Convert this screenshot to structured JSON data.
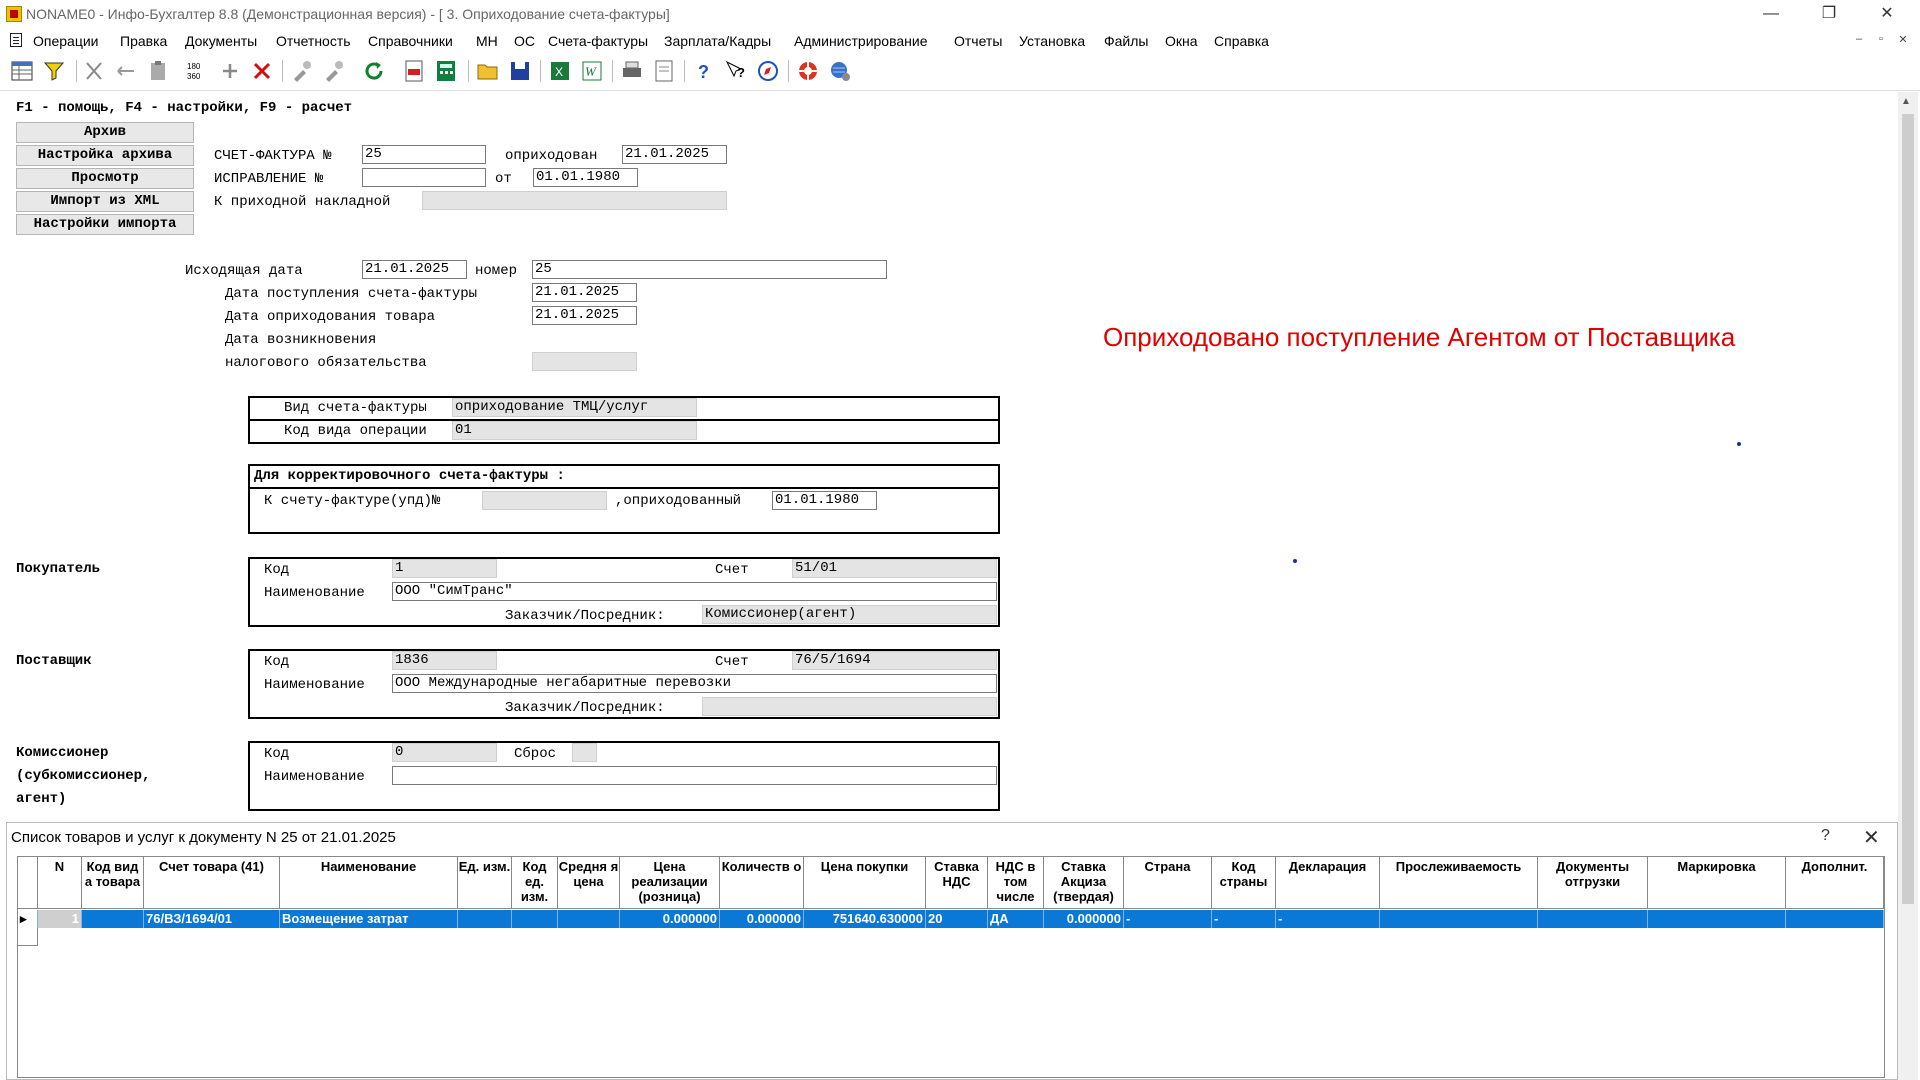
{
  "window": {
    "title": "NONAME0 - Инфо-Бухгалтер 8.8 (Демонстрационная версия) - [  3. Оприходование счета-фактуры]"
  },
  "menu": [
    "Операции",
    "Правка",
    "Документы",
    "Отчетность",
    "Справочники",
    "МН",
    "ОС",
    "Счета-фактуры",
    "Зарплата/Кадры",
    "Администрирование",
    "Отчеты",
    "Установка",
    "Файлы",
    "Окна",
    "Справка"
  ],
  "toolbar_icons": [
    "table-icon",
    "filter-icon",
    "cut-icon",
    "move-icon",
    "paste-icon",
    "number-icon",
    "add-icon",
    "delete-icon",
    "tool-icon",
    "tool2-icon",
    "refresh-icon",
    "pdf-icon",
    "calc-icon",
    "open-icon",
    "save-icon",
    "excel-icon",
    "word-icon",
    "print-icon",
    "preview-icon",
    "help-icon",
    "help-context-icon",
    "compass-icon",
    "lifebuoy-icon",
    "globe-icon"
  ],
  "form": {
    "hint": "F1 - помощь, F4 - настройки, F9 - расчет",
    "side_buttons": [
      "Архив",
      "Настройка архива",
      "Просмотр",
      "Импорт из XML",
      "Настройки импорта"
    ],
    "invoice_label": "СЧЕТ-ФАКТУРА №",
    "invoice_no": "25",
    "posted_label": "оприходован",
    "posted_date": "21.01.2025",
    "correction_label": "ИСПРАВЛЕНИЕ  №",
    "correction_no": "",
    "from_label": "от",
    "correction_date": "01.01.1980",
    "to_receipt_label": "К приходной накладной",
    "to_receipt_value": "",
    "outgoing_date_label": "Исходящая дата",
    "outgoing_date": "21.01.2025",
    "number_label": "номер",
    "number": "25",
    "invoice_receipt_label": "Дата поступления счета-фактуры",
    "invoice_receipt_date": "21.01.2025",
    "goods_posting_label": "Дата оприходования товара",
    "goods_posting_date": "21.01.2025",
    "occurrence_label_1": "Дата возникновения",
    "occurrence_label_2": "налогового обязательства",
    "occurrence_date": "",
    "invoice_type_label": "Вид счета-фактуры",
    "invoice_type": "оприходование ТМЦ/услуг",
    "operation_code_label": "Код вида операции",
    "operation_code": "01",
    "corrective_header": "Для корректировочного счета-фактуры :",
    "corrective_to_label": "К счету-фактуре(упд)№",
    "corrective_to_value": "",
    "corrective_posted_label": ",оприходованный",
    "corrective_posted_date": "01.01.1980",
    "buyer": {
      "title": "Покупатель",
      "code_label": "Код",
      "code": "1",
      "account_label": "Счет",
      "account": "51/01",
      "name_label": "Наименование",
      "name": "ООО \"СимТранс\"",
      "customer_label": "Заказчик/Посредник:",
      "customer": "Комиссионер(агент)"
    },
    "supplier": {
      "title": "Поставщик",
      "code_label": "Код",
      "code": "1836",
      "account_label": "Счет",
      "account": "76/5/1694",
      "name_label": "Наименование",
      "name": "ООО Международные негабаритные перевозки",
      "customer_label": "Заказчик/Посредник:",
      "customer": ""
    },
    "commissioner": {
      "title_1": "Комиссионер",
      "title_2": "(субкомиссионер,",
      "title_3": "агент)",
      "code_label": "Код",
      "code": "0",
      "reset_label": "Сброс",
      "reset": "",
      "name_label": "Наименование",
      "name": ""
    },
    "status_message": "Оприходовано поступление Агентом от Поставщика"
  },
  "dialog": {
    "title": "Список товаров и услуг к документу N 25 от 21.01.2025",
    "help": "?",
    "close": "✕",
    "columns": [
      "N",
      "Код вид а товара",
      "Счет товара (41)",
      "Наименование",
      "Ед. изм.",
      "Код ед. изм.",
      "Средня я цена",
      "Цена реализации (розница)",
      "Количеств о",
      "Цена покупки",
      "Ставка НДС",
      "НДС в том числе",
      "Ставка Акциза (твердая)",
      "Страна",
      "Код страны",
      "Декларация",
      "Прослеживаемость",
      "Документы отгрузки",
      "Маркировка",
      "Дополнит."
    ],
    "rows": [
      {
        "n": "1",
        "kind": "",
        "account": "76/ВЗ/1694/01",
        "name": "Возмещение затрат",
        "unit": "",
        "unit_code": "",
        "avg_price": "",
        "retail_price": "0.000000",
        "quantity": "0.000000",
        "purchase_price": "751640.630000",
        "vat_rate": "20",
        "vat_incl": "ДА",
        "excise": "0.000000",
        "country": "-",
        "country_code": "-",
        "declaration": "-",
        "trace": "",
        "shipping_docs": "",
        "marking": "",
        "extra": ""
      }
    ]
  }
}
